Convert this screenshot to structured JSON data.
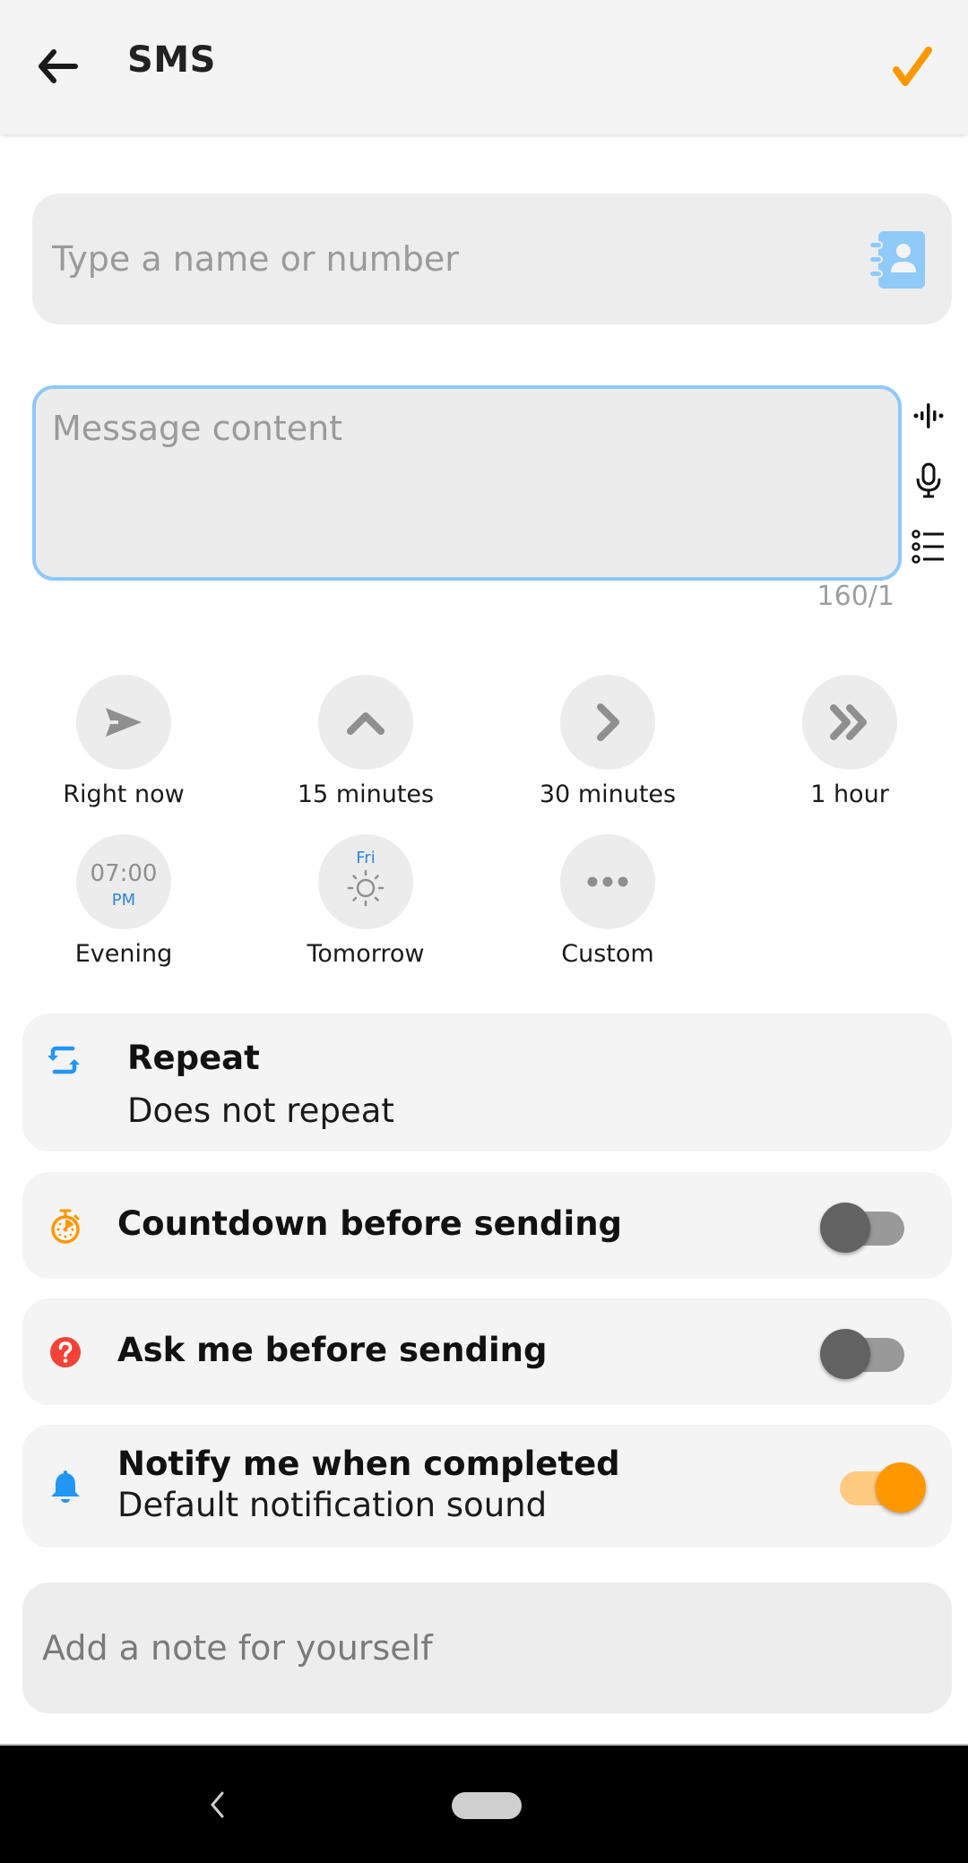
{
  "appbar": {
    "title": "SMS",
    "back_icon": "arrow-left-icon",
    "confirm_icon": "checkmark-icon",
    "accent_color": "#ff9800"
  },
  "recipient": {
    "placeholder": "Type a name or number",
    "value": "",
    "icon": "contacts-book-icon"
  },
  "message": {
    "placeholder": "Message content",
    "value": "",
    "counter": "160/1",
    "side_icons": [
      "voice-wave-icon",
      "microphone-icon",
      "list-icon"
    ]
  },
  "quick_times": [
    {
      "label": "Right now",
      "icon": "send-icon"
    },
    {
      "label": "15 minutes",
      "icon": "chevron-up-icon"
    },
    {
      "label": "30 minutes",
      "icon": "chevron-right-icon"
    },
    {
      "label": "1 hour",
      "icon": "double-chevron-right-icon"
    },
    {
      "label": "Evening",
      "icon_time": "07:00",
      "icon_ampm": "PM"
    },
    {
      "label": "Tomorrow",
      "icon_day": "Fri",
      "icon": "sun-icon"
    },
    {
      "label": "Custom",
      "icon": "more-dots-icon"
    }
  ],
  "repeat": {
    "title": "Repeat",
    "value": "Does not repeat",
    "icon": "repeat-icon"
  },
  "options": [
    {
      "title": "Countdown before sending",
      "icon": "stopwatch-icon",
      "enabled": false
    },
    {
      "title": "Ask me before sending",
      "icon": "question-icon",
      "enabled": false
    },
    {
      "title": "Notify me when completed",
      "subtitle": "Default notification sound",
      "icon": "bell-icon",
      "enabled": true
    }
  ],
  "note": {
    "placeholder": "Add a note for yourself",
    "value": ""
  },
  "colors": {
    "accent": "#ff9800",
    "blue": "#2196f3",
    "red": "#f44336",
    "focus_border": "#90c8f8"
  }
}
